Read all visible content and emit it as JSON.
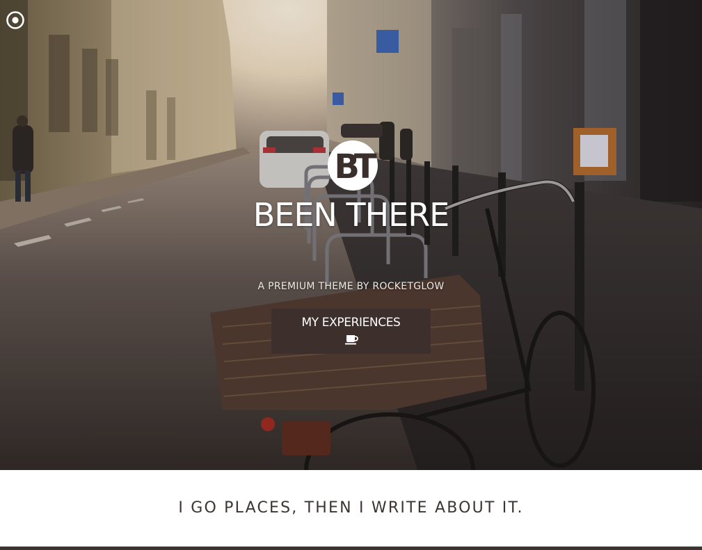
{
  "hero": {
    "logo_text": "BT",
    "title": "BEEN THERE",
    "tagline": "A PREMIUM THEME BY ROCKETGLOW",
    "cta_label": "MY EXPERIENCES",
    "cta_icon": "coffee-cup-icon",
    "menu_icon": "circle-menu-icon"
  },
  "intro": {
    "text": "I GO PLACES, THEN I WRITE ABOUT IT."
  },
  "colors": {
    "button_bg": "#3c2f2c",
    "footer_bar": "#3b3432",
    "intro_text": "#3a3533"
  }
}
